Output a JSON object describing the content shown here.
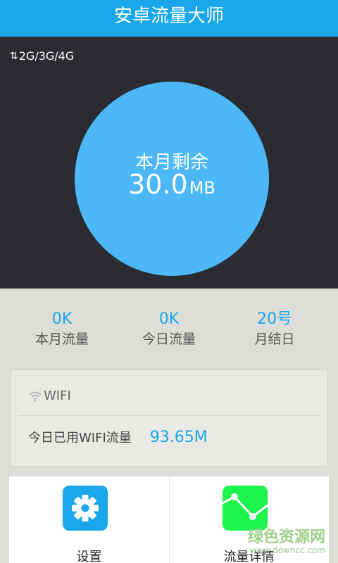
{
  "app": {
    "title": "安卓流量大师"
  },
  "network": {
    "arrows": "⇅",
    "type": "2G/3G/4G"
  },
  "remaining": {
    "label": "本月剩余",
    "value": "30.0",
    "unit": "MB"
  },
  "stats": [
    {
      "value": "0K",
      "label": "本月流量"
    },
    {
      "value": "0K",
      "label": "今日流量"
    },
    {
      "value": "20号",
      "label": "月结日"
    }
  ],
  "wifi": {
    "title": "WIFI",
    "used_label": "今日已用WIFI流量",
    "used_value": "93.65M"
  },
  "actions": {
    "settings_label": "设置",
    "details_label": "流量详情"
  },
  "watermark": {
    "name": "绿色资源网",
    "url": "www.downcc.com"
  },
  "colors": {
    "primary": "#1aa6ea",
    "circle": "#4cb8f7",
    "dark_bg": "#2a2c31",
    "details_icon": "#1ef44e"
  }
}
